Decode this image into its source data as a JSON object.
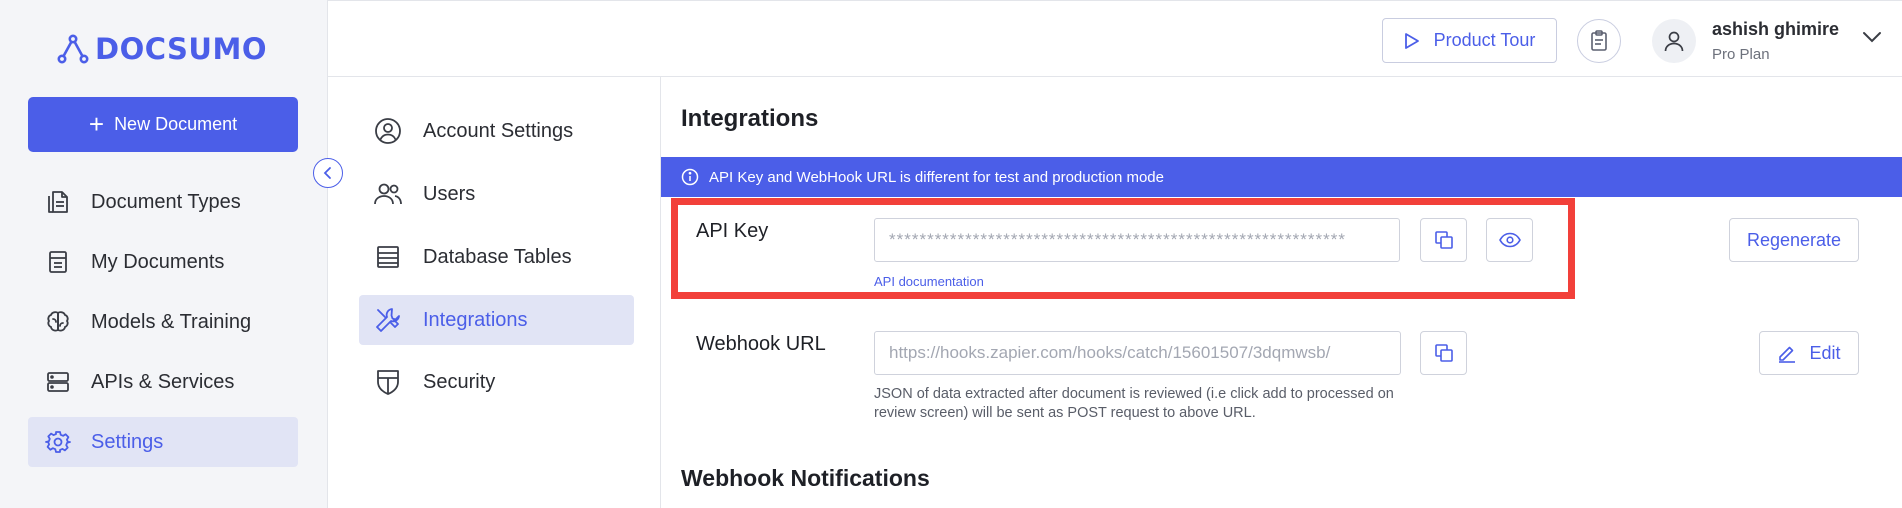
{
  "brand": {
    "name": "DOCSUMO",
    "color": "#4b5ee8"
  },
  "sidebar": {
    "new_document_label": "New Document",
    "items": [
      {
        "label": "Document Types",
        "icon": "document-types-icon",
        "active": false
      },
      {
        "label": "My Documents",
        "icon": "my-documents-icon",
        "active": false
      },
      {
        "label": "Models & Training",
        "icon": "brain-icon",
        "active": false
      },
      {
        "label": "APIs & Services",
        "icon": "server-icon",
        "active": false
      },
      {
        "label": "Settings",
        "icon": "gear-icon",
        "active": true
      }
    ]
  },
  "header": {
    "product_tour_label": "Product Tour",
    "user": {
      "name": "ashish ghimire",
      "plan": "Pro Plan"
    }
  },
  "settings_nav": {
    "items": [
      {
        "label": "Account Settings",
        "icon": "account-icon",
        "active": false
      },
      {
        "label": "Users",
        "icon": "users-icon",
        "active": false
      },
      {
        "label": "Database Tables",
        "icon": "table-icon",
        "active": false
      },
      {
        "label": "Integrations",
        "icon": "tools-icon",
        "active": true
      },
      {
        "label": "Security",
        "icon": "shield-icon",
        "active": false
      }
    ]
  },
  "integrations": {
    "title": "Integrations",
    "banner": "API Key and WebHook URL is different for test and production mode",
    "api_key": {
      "label": "API Key",
      "masked_value": "************************************************************",
      "doc_link": "API documentation",
      "regenerate_label": "Regenerate"
    },
    "webhook": {
      "label": "Webhook URL",
      "value": "https://hooks.zapier.com/hooks/catch/15601507/3dqmwsb/",
      "edit_label": "Edit",
      "helper_text": "JSON of data extracted after document is reviewed (i.e click add to processed on review screen) will be sent as POST request to above URL."
    },
    "notifications_title": "Webhook Notifications"
  },
  "colors": {
    "accent": "#4b5ee8",
    "highlight": "#f2403a",
    "active_bg": "#e1e4f5"
  }
}
